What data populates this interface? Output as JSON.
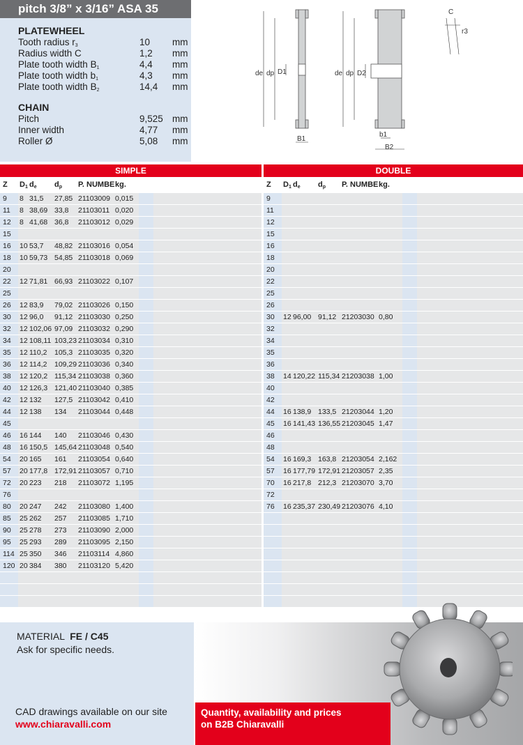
{
  "header": {
    "title": "pitch 3/8” x 3/16” ASA 35"
  },
  "platewheel": {
    "title": "PLATEWHEEL",
    "rows": [
      {
        "label": "Tooth radius r",
        "sub": "3",
        "value": "10",
        "unit": "mm"
      },
      {
        "label": "Radius width C",
        "sub": "",
        "value": "1,2",
        "unit": "mm"
      },
      {
        "label": "Plate tooth width B",
        "sub": "1",
        "value": "4,4",
        "unit": "mm"
      },
      {
        "label": "Plate tooth width b",
        "sub": "1",
        "value": "4,3",
        "unit": "mm"
      },
      {
        "label": "Plate tooth width B",
        "sub": "2",
        "value": "14,4",
        "unit": "mm"
      }
    ]
  },
  "chain": {
    "title": "CHAIN",
    "rows": [
      {
        "label": "Pitch",
        "value": "9,525",
        "unit": "mm"
      },
      {
        "label": "Inner width",
        "value": "4,77",
        "unit": "mm"
      },
      {
        "label": "Roller Ø",
        "value": "5,08",
        "unit": "mm"
      }
    ]
  },
  "drawing": {
    "labels": [
      "C",
      "r3",
      "de",
      "dp",
      "D1",
      "B1",
      "de",
      "dp",
      "D2",
      "b1",
      "B2"
    ]
  },
  "columns": {
    "z": "Z",
    "d1": "D",
    "d1_sub": "1",
    "de": "d",
    "de_sub": "e",
    "dp": "d",
    "dp_sub": "p",
    "pn": "P. NUMBER",
    "kg": "kg."
  },
  "simple": {
    "title": "SIMPLE",
    "rows": [
      [
        "9",
        "8",
        "31,5",
        "27,85",
        "21103009",
        "0,015"
      ],
      [
        "11",
        "8",
        "38,69",
        "33,8",
        "21103011",
        "0,020"
      ],
      [
        "12",
        "8",
        "41,68",
        "36,8",
        "21103012",
        "0,029"
      ],
      [
        "15",
        "",
        "",
        "",
        "",
        ""
      ],
      [
        "16",
        "10",
        "53,7",
        "48,82",
        "21103016",
        "0,054"
      ],
      [
        "18",
        "10",
        "59,73",
        "54,85",
        "21103018",
        "0,069"
      ],
      [
        "20",
        "",
        "",
        "",
        "",
        ""
      ],
      [
        "22",
        "12",
        "71,81",
        "66,93",
        "21103022",
        "0,107"
      ],
      [
        "25",
        "",
        "",
        "",
        "",
        ""
      ],
      [
        "26",
        "12",
        "83,9",
        "79,02",
        "21103026",
        "0,150"
      ],
      [
        "30",
        "12",
        "96,0",
        "91,12",
        "21103030",
        "0,250"
      ],
      [
        "32",
        "12",
        "102,06",
        "97,09",
        "21103032",
        "0,290"
      ],
      [
        "34",
        "12",
        "108,11",
        "103,23",
        "21103034",
        "0,310"
      ],
      [
        "35",
        "12",
        "110,2",
        "105,3",
        "21103035",
        "0,320"
      ],
      [
        "36",
        "12",
        "114,2",
        "109,29",
        "21103036",
        "0,340"
      ],
      [
        "38",
        "12",
        "120,2",
        "115,34",
        "21103038",
        "0,360"
      ],
      [
        "40",
        "12",
        "126,3",
        "121,40",
        "21103040",
        "0,385"
      ],
      [
        "42",
        "12",
        "132",
        "127,5",
        "21103042",
        "0,410"
      ],
      [
        "44",
        "12",
        "138",
        "134",
        "21103044",
        "0,448"
      ],
      [
        "45",
        "",
        "",
        "",
        "",
        ""
      ],
      [
        "46",
        "16",
        "144",
        "140",
        "21103046",
        "0,430"
      ],
      [
        "48",
        "16",
        "150,5",
        "145,64",
        "21103048",
        "0,540"
      ],
      [
        "54",
        "20",
        "165",
        "161",
        "21103054",
        "0,640"
      ],
      [
        "57",
        "20",
        "177,8",
        "172,91",
        "21103057",
        "0,710"
      ],
      [
        "72",
        "20",
        "223",
        "218",
        "21103072",
        "1,195"
      ],
      [
        "76",
        "",
        "",
        "",
        "",
        ""
      ],
      [
        "80",
        "20",
        "247",
        "242",
        "21103080",
        "1,400"
      ],
      [
        "85",
        "25",
        "262",
        "257",
        "21103085",
        "1,710"
      ],
      [
        "90",
        "25",
        "278",
        "273",
        "21103090",
        "2,000"
      ],
      [
        "95",
        "25",
        "293",
        "289",
        "21103095",
        "2,150"
      ],
      [
        "114",
        "25",
        "350",
        "346",
        "21103114",
        "4,860"
      ],
      [
        "120",
        "20",
        "384",
        "380",
        "21103120",
        "5,420"
      ],
      [
        "",
        "",
        "",
        "",
        "",
        ""
      ],
      [
        "",
        "",
        "",
        "",
        "",
        ""
      ],
      [
        "",
        "",
        "",
        "",
        "",
        ""
      ]
    ]
  },
  "double": {
    "title": "DOUBLE",
    "rows": [
      [
        "9",
        "",
        "",
        "",
        "",
        ""
      ],
      [
        "11",
        "",
        "",
        "",
        "",
        ""
      ],
      [
        "12",
        "",
        "",
        "",
        "",
        ""
      ],
      [
        "15",
        "",
        "",
        "",
        "",
        ""
      ],
      [
        "16",
        "",
        "",
        "",
        "",
        ""
      ],
      [
        "18",
        "",
        "",
        "",
        "",
        ""
      ],
      [
        "20",
        "",
        "",
        "",
        "",
        ""
      ],
      [
        "22",
        "",
        "",
        "",
        "",
        ""
      ],
      [
        "25",
        "",
        "",
        "",
        "",
        ""
      ],
      [
        "26",
        "",
        "",
        "",
        "",
        ""
      ],
      [
        "30",
        "12",
        "96,00",
        "91,12",
        "21203030",
        "0,80"
      ],
      [
        "32",
        "",
        "",
        "",
        "",
        ""
      ],
      [
        "34",
        "",
        "",
        "",
        "",
        ""
      ],
      [
        "35",
        "",
        "",
        "",
        "",
        ""
      ],
      [
        "36",
        "",
        "",
        "",
        "",
        ""
      ],
      [
        "38",
        "14",
        "120,22",
        "115,34",
        "21203038",
        "1,00"
      ],
      [
        "40",
        "",
        "",
        "",
        "",
        ""
      ],
      [
        "42",
        "",
        "",
        "",
        "",
        ""
      ],
      [
        "44",
        "16",
        "138,9",
        "133,5",
        "21203044",
        "1,20"
      ],
      [
        "45",
        "16",
        "141,43",
        "136,55",
        "21203045",
        "1,47"
      ],
      [
        "46",
        "",
        "",
        "",
        "",
        ""
      ],
      [
        "48",
        "",
        "",
        "",
        "",
        ""
      ],
      [
        "54",
        "16",
        "169,3",
        "163,8",
        "21203054",
        "2,162"
      ],
      [
        "57",
        "16",
        "177,79",
        "172,91",
        "21203057",
        "2,35"
      ],
      [
        "70",
        "16",
        "217,8",
        "212,3",
        "21203070",
        "3,70"
      ],
      [
        "72",
        "",
        "",
        "",
        "",
        ""
      ],
      [
        "76",
        "16",
        "235,37",
        "230,49",
        "21203076",
        "4,10"
      ],
      [
        "",
        "",
        "",
        "",
        "",
        ""
      ],
      [
        "",
        "",
        "",
        "",
        "",
        ""
      ],
      [
        "",
        "",
        "",
        "",
        "",
        ""
      ],
      [
        "",
        "",
        "",
        "",
        "",
        ""
      ],
      [
        "",
        "",
        "",
        "",
        "",
        ""
      ],
      [
        "",
        "",
        "",
        "",
        "",
        ""
      ],
      [
        "",
        "",
        "",
        "",
        "",
        ""
      ],
      [
        "",
        "",
        "",
        "",
        "",
        ""
      ]
    ]
  },
  "footer": {
    "material_label": "MATERIAL",
    "material_value": "FE / C45",
    "ask": "Ask for specific needs.",
    "cad": "CAD drawings available on our site",
    "url": "www.chiaravalli.com",
    "promo_line1": "Quantity, availability and prices",
    "promo_line2": "on B2B Chiaravalli"
  }
}
